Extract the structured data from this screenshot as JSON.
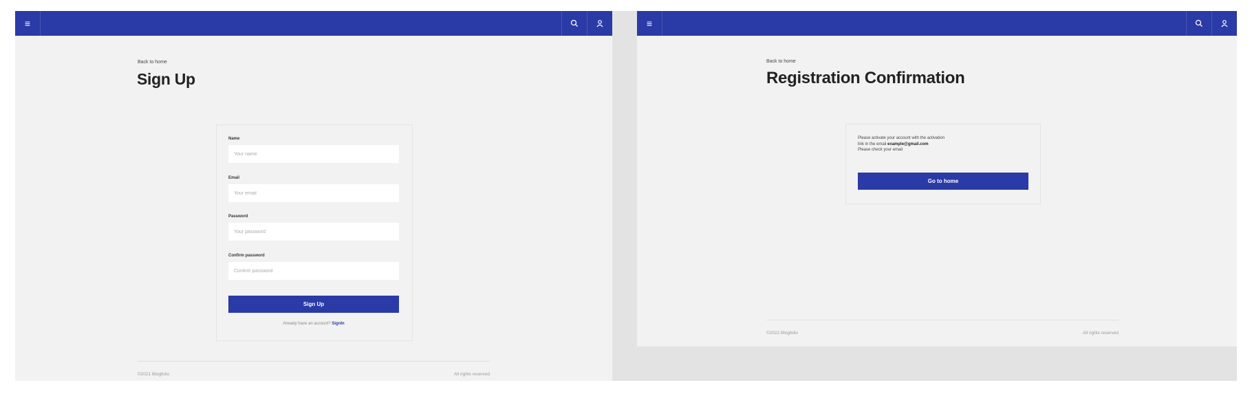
{
  "colors": {
    "primary": "#2a3aa6",
    "page_bg": "#f2f2f2",
    "outer_bg": "#e3e3e3"
  },
  "nav": {
    "menu_icon": "menu-icon",
    "search_icon": "search-icon",
    "user_icon": "user-icon"
  },
  "signup": {
    "back_link": "Back to home",
    "title": "Sign Up",
    "fields": {
      "name": {
        "label": "Name",
        "placeholder": "Your name"
      },
      "email": {
        "label": "Email",
        "placeholder": "Your email"
      },
      "password": {
        "label": "Password",
        "placeholder": "Your password"
      },
      "confirm": {
        "label": "Confirm password",
        "placeholder": "Confirm password"
      }
    },
    "submit_label": "Sign Up",
    "signin_prompt": "Already have an account?",
    "signin_link": "SignIn",
    "footer": {
      "copyright": "©2021 Blogfolio",
      "rights": "All rights reserved"
    }
  },
  "confirmation": {
    "back_link": "Back to home",
    "title": "Registration Confirmation",
    "message_line1": "Please activate your account with the activation",
    "message_line2_prefix": "link in the email",
    "email": "example@gmail.com",
    "message_line3": "Please check your email",
    "button_label": "Go to home",
    "footer": {
      "copyright": "©2022 Blogfolio",
      "rights": "All rights reserved"
    }
  }
}
